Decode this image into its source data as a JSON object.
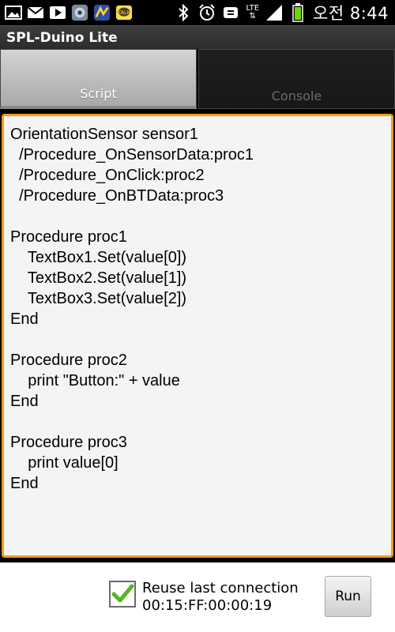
{
  "status_bar": {
    "left_icons": [
      "image-icon",
      "gmail-icon",
      "youtube-icon",
      "game-icon",
      "tile-app-icon",
      "kakaotalk-icon"
    ],
    "right_icons": [
      "bluetooth-icon",
      "alarm-icon",
      "silent-mode-icon",
      "lte-icon",
      "signal-icon",
      "battery-icon"
    ],
    "lte_label": "LTE",
    "time": "오전 8:44",
    "battery_color": "#6bd600"
  },
  "app": {
    "title": "SPL-Duino Lite"
  },
  "tabs": [
    {
      "label": "Script",
      "active": true
    },
    {
      "label": "Console",
      "active": false
    }
  ],
  "editor": {
    "border_color": "#f79b18",
    "code": "OrientationSensor sensor1\n  /Procedure_OnSensorData:proc1\n  /Procedure_OnClick:proc2\n  /Procedure_OnBTData:proc3\n\nProcedure proc1\n    TextBox1.Set(value[0])\n    TextBox2.Set(value[1])\n    TextBox3.Set(value[2])\nEnd\n\nProcedure proc2\n    print \"Button:\" + value\nEnd\n\nProcedure proc3\n    print value[0]\nEnd"
  },
  "bottom": {
    "checkbox_checked": true,
    "checkbox_label": "Reuse last connection",
    "connection_address": "00:15:FF:00:00:19",
    "run_label": "Run",
    "check_color": "#4fb81e"
  }
}
